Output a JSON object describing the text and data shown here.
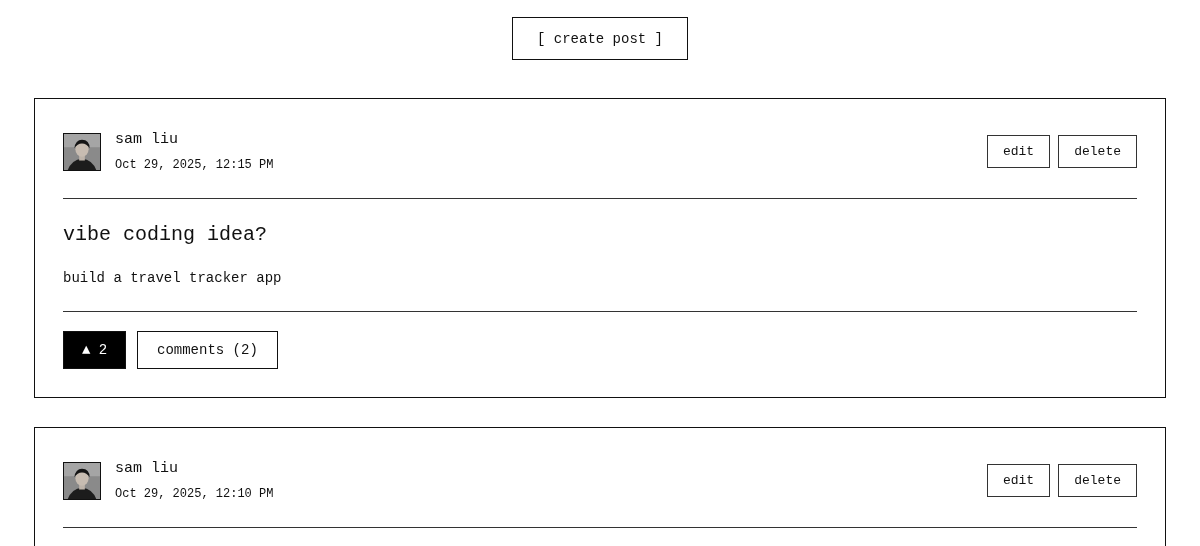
{
  "create_button": "[ create post ]",
  "posts": [
    {
      "author": "sam liu",
      "date": "Oct 29, 2025, 12:15 PM",
      "actions": [
        "edit",
        "delete"
      ],
      "title": "vibe coding idea?",
      "body": "build a travel tracker app",
      "vote": {
        "label": "▲ 2",
        "selected": true
      },
      "comments": "comments (2)"
    },
    {
      "author": "sam liu",
      "date": "Oct 29, 2025, 12:10 PM",
      "actions": [
        "edit",
        "delete"
      ]
    }
  ]
}
